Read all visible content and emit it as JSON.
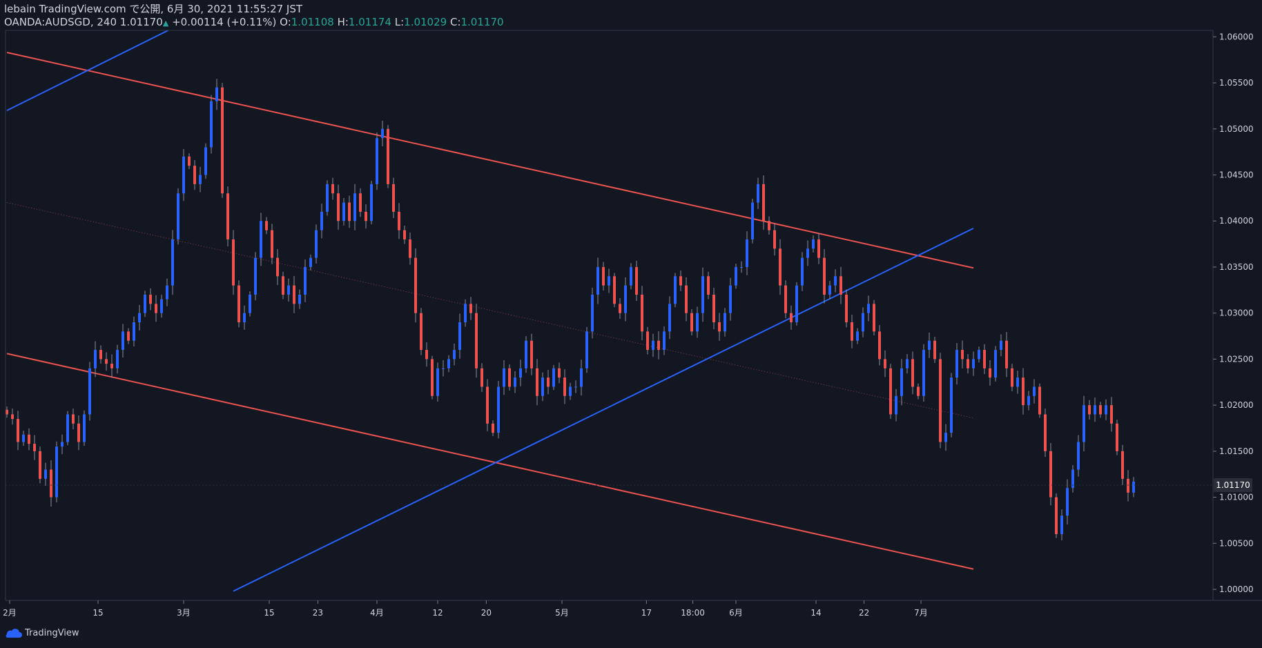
{
  "header": {
    "publish_line": "lebain TradingView.com で公開, 6月 30, 2021 11:55:27 JST",
    "symbol": "OANDA:AUDSGD, 240",
    "last": "1.01170",
    "change": "+0.00114 (+0.11%)",
    "o_label": "O:",
    "o": "1.01108",
    "h_label": "H:",
    "h": "1.01174",
    "l_label": "L:",
    "l": "1.01029",
    "c_label": "C:",
    "c": "1.01170"
  },
  "footer": {
    "brand": "TradingView"
  },
  "colors": {
    "background": "#131722",
    "up": "#2962ff",
    "down": "#ef5350",
    "text": "#d1d4dc",
    "axis": "#363a45",
    "price_tag": "#2a2e39"
  },
  "chart_data": {
    "type": "candlestick",
    "symbol": "OANDA:AUDSGD",
    "interval": "240",
    "ylim": [
      0.9988,
      1.0607
    ],
    "y_ticks": [
      1.06,
      1.055,
      1.05,
      1.045,
      1.04,
      1.035,
      1.03,
      1.025,
      1.02,
      1.015,
      1.01,
      1.005,
      1.0
    ],
    "y_tick_labels": [
      "1.06000",
      "1.05500",
      "1.05000",
      "1.04500",
      "1.04000",
      "1.03500",
      "1.03000",
      "1.02500",
      "1.02000",
      "1.01500",
      "1.01000",
      "1.00500",
      "1.00000"
    ],
    "x_ticks": [
      {
        "label": "2月",
        "t": 0.5
      },
      {
        "label": "15",
        "t": 16.5
      },
      {
        "label": "3月",
        "t": 32
      },
      {
        "label": "15",
        "t": 47.5
      },
      {
        "label": "23",
        "t": 56.3
      },
      {
        "label": "4月",
        "t": 67
      },
      {
        "label": "12",
        "t": 78
      },
      {
        "label": "20",
        "t": 86.8
      },
      {
        "label": "5月",
        "t": 100.5
      },
      {
        "label": "17",
        "t": 115.8
      },
      {
        "label": "18:00",
        "t": 124.2
      },
      {
        "label": "6月",
        "t": 132
      },
      {
        "label": "14",
        "t": 146.5
      },
      {
        "label": "22",
        "t": 155.2
      },
      {
        "label": "7月",
        "t": 165.5
      }
    ],
    "last_price": {
      "value": 1.0117,
      "label": "1.01170"
    },
    "trend_lines": [
      {
        "name": "channel-upper",
        "color": "#ef5350",
        "p1": [
          0,
          1.0583
        ],
        "p2": [
          175,
          1.0349
        ]
      },
      {
        "name": "channel-lower",
        "color": "#ef5350",
        "p1": [
          0,
          1.0256
        ],
        "p2": [
          175,
          1.0022
        ]
      },
      {
        "name": "channel-mid",
        "color": "#ef5350",
        "style": "dotted",
        "p1": [
          0,
          1.042
        ],
        "p2": [
          175,
          1.0186
        ]
      },
      {
        "name": "support-blue",
        "color": "#2962ff",
        "p1": [
          41,
          0.9998
        ],
        "p2": [
          175,
          1.0392
        ]
      },
      {
        "name": "support-blue-upper",
        "color": "#2962ff",
        "p1": [
          0,
          1.052
        ],
        "p2": [
          29.2,
          1.0607
        ]
      }
    ],
    "closes": [
      1.019,
      1.0185,
      1.016,
      1.0168,
      1.0158,
      1.015,
      1.012,
      1.013,
      1.01,
      1.0155,
      1.016,
      1.019,
      1.018,
      1.016,
      1.019,
      1.024,
      1.026,
      1.025,
      1.0245,
      1.024,
      1.026,
      1.028,
      1.027,
      1.029,
      1.03,
      1.032,
      1.031,
      1.03,
      1.0315,
      1.033,
      1.038,
      1.043,
      1.047,
      1.046,
      1.044,
      1.045,
      1.048,
      1.053,
      1.0545,
      1.043,
      1.038,
      1.033,
      1.029,
      1.03,
      1.032,
      1.036,
      1.04,
      1.039,
      1.036,
      1.034,
      1.032,
      1.033,
      1.031,
      1.032,
      1.035,
      1.036,
      1.039,
      1.041,
      1.044,
      1.043,
      1.04,
      1.042,
      1.04,
      1.043,
      1.041,
      1.04,
      1.044,
      1.049,
      1.05,
      1.044,
      1.041,
      1.039,
      1.038,
      1.036,
      1.03,
      1.026,
      1.025,
      1.021,
      1.024,
      1.024,
      1.025,
      1.026,
      1.029,
      1.031,
      1.03,
      1.024,
      1.022,
      1.018,
      1.017,
      1.022,
      1.024,
      1.022,
      1.023,
      1.024,
      1.027,
      1.024,
      1.021,
      1.023,
      1.022,
      1.024,
      1.023,
      1.021,
      1.022,
      1.022,
      1.024,
      1.028,
      1.032,
      1.035,
      1.033,
      1.034,
      1.031,
      1.03,
      1.033,
      1.035,
      1.032,
      1.028,
      1.026,
      1.027,
      1.026,
      1.028,
      1.031,
      1.034,
      1.033,
      1.03,
      1.028,
      1.03,
      1.034,
      1.032,
      1.029,
      1.028,
      1.03,
      1.033,
      1.035,
      1.035,
      1.038,
      1.042,
      1.044,
      1.04,
      1.039,
      1.037,
      1.033,
      1.03,
      1.029,
      1.033,
      1.036,
      1.037,
      1.038,
      1.036,
      1.032,
      1.033,
      1.034,
      1.032,
      1.029,
      1.027,
      1.028,
      1.03,
      1.031,
      1.028,
      1.025,
      1.024,
      1.019,
      1.021,
      1.024,
      1.025,
      1.022,
      1.021,
      1.026,
      1.027,
      1.025,
      1.016,
      1.017,
      1.023,
      1.026,
      1.025,
      1.024,
      1.025,
      1.026,
      1.024,
      1.023,
      1.026,
      1.027,
      1.024,
      1.022,
      1.023,
      1.02,
      1.021,
      1.022,
      1.019,
      1.015,
      1.01,
      1.006,
      1.008,
      1.011,
      1.013,
      1.016,
      1.02,
      1.019,
      1.02,
      1.019,
      1.02,
      1.018,
      1.015,
      1.012,
      1.0105,
      1.0117
    ]
  }
}
